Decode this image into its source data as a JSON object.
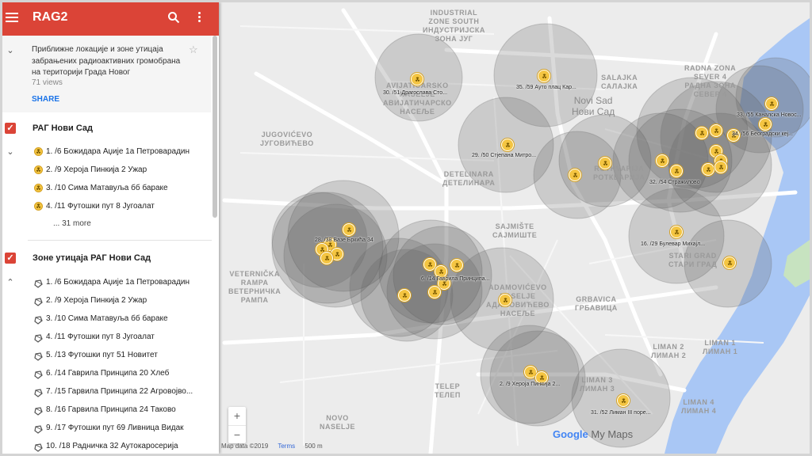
{
  "app": {
    "title": "RAG2"
  },
  "header": {
    "description": "Приближне локације и зоне утицаја забрањених радиоактивних громобрана на територији Града Новог",
    "views": "71 views",
    "share_label": "SHARE"
  },
  "layers": [
    {
      "title": "РАГ Нови Сад",
      "checked": true,
      "icon": "radiation-icon",
      "items": [
        "1. /6 Божидара Аџије 1а Петроварадин",
        "2. /9 Хероја Пинкија 2 Ужар",
        "3. /10 Сима Матавуља бб бараке",
        "4. /11 Футошки пут 8 Југоалат"
      ],
      "more_label": "... 31 more"
    },
    {
      "title": "Зоне утицаја РАГ Нови Сад",
      "checked": true,
      "icon": "polygon-icon",
      "items": [
        "1. /6 Божидара Аџије 1а Петроварадин",
        "2. /9 Хероја Пинкија 2 Ужар",
        "3. /10 Сима Матавуља бб бараке",
        "4. /11 Футошки пут 8 Југоалат",
        "5. /13 Футошки пут 51 Новитет",
        "6. /14 Гаврила Принципа 20 Хлеб",
        "7. /15 Гарвила Принципа 22 Агровојво...",
        "8. /16 Гарвила Принципа 24 Таково",
        "9. /17 Футошки пут 69 Ливница Видак",
        "10. /18 Радничка 32 Аутокаросерија"
      ]
    }
  ],
  "map": {
    "district_labels": [
      "INDUSTRIAL\nZONE SOUTH\nИНДУСТРИЈСКА\nЗОНА ЈУГ",
      "AVIJATIČARSKO\nNASELJE\nАВИЈАТИЧАРСКО\nНАСЕЉЕ",
      "JUGOVIĆEVO\nЈУГОВИЋЕВО",
      "DETELINARA\nДЕТЕЛИНАРА",
      "VETERNIČKA\nRAMPA\nВЕТЕРНИЧКА\nРАМПА",
      "SAJMIŠTE\nСАЈМИШТЕ",
      "ADAMOVIĆEVO\nNASELJE\nАДАМОВИЋЕВО\nНАСЕЉЕ",
      "GRBAVICA\nГРБАВИЦА",
      "TELEP\nТЕЛЕП",
      "SALAJKA\nСАЛАЈКА",
      "RADNA ZONA\nSEVER 4\nРАДНА ЗОНА\nСЕВЕР 4",
      "ROTKVARIJA\nРОТКВАРИЈА",
      "STARI GRAD\nСТАРИ ГРАД",
      "LIMAN 1\nЛИМАН 1",
      "LIMAN 2\nЛИМАН 2",
      "LIMAN 3\nЛИМАН 3",
      "LIMAN 4\nЛИМАН 4",
      "NOVO\nNASELJE"
    ],
    "city_label": "Novi Sad\nНови Сад",
    "marker_labels": [
      "30. /51 Драгослава Сто...",
      "35. /59 Ауто плац Кар...",
      "29. /50 Стјепана Митро...",
      "32. /54 Стражилово",
      "33. /55 Каналска Новос...",
      "34. /56 Београдски кеј...",
      "28. /38 Вазе Бркића 34",
      "6. /14 Гаврила Принципа...",
      "16. /29 Булевар Михајл...",
      "2. /9 Хероја Пинкија 2...",
      "31. /52 Лиман III поре..."
    ],
    "zoom_in": "+",
    "zoom_out": "−"
  },
  "footer": {
    "map_data": "Map data ©2019",
    "terms": "Terms",
    "scale": "500 m"
  },
  "brand": {
    "google": "Google",
    "my_maps": "My Maps"
  },
  "colors": {
    "header": "#db4437",
    "marker": "#f4c542",
    "zone": "#555555",
    "water": "#a9c7f5"
  }
}
